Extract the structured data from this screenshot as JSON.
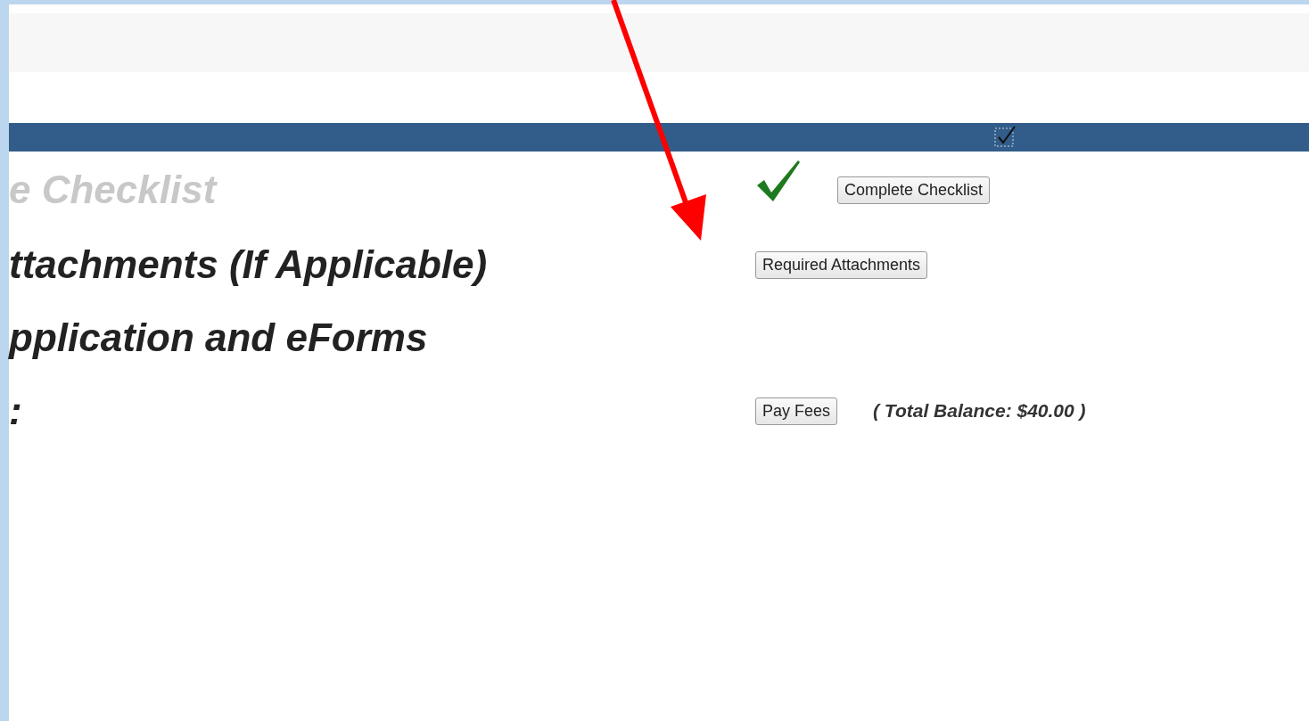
{
  "header_bar": {
    "checked": true
  },
  "steps": [
    {
      "label": "e Checklist",
      "completed": true,
      "button": "Complete Checklist"
    },
    {
      "label": "ttachments (If Applicable)",
      "completed": false,
      "button": "Required Attachments"
    },
    {
      "label": "pplication and eForms",
      "completed": false
    },
    {
      "label": ":",
      "completed": false,
      "button": "Pay Fees",
      "note": "( Total Balance: $40.00 )"
    }
  ]
}
